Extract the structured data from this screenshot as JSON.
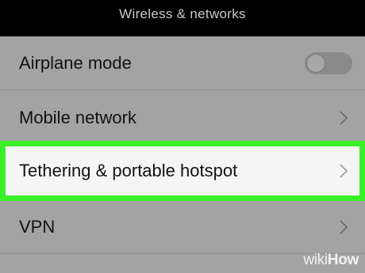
{
  "header": {
    "title": "Wireless & networks"
  },
  "settings": {
    "items": [
      {
        "label": "Airplane mode",
        "control": "toggle",
        "toggle_state": "off"
      },
      {
        "label": "Mobile network",
        "control": "chevron-right"
      },
      {
        "label": "Tethering & portable hotspot",
        "control": "chevron-right",
        "highlighted": true,
        "highlight_color": "#3af029"
      },
      {
        "label": "VPN",
        "control": "chevron-right"
      }
    ]
  },
  "watermark": {
    "part1": "wiki",
    "part2": "How"
  },
  "colors": {
    "header_bg": "#000000",
    "list_bg": "#a3a3a3",
    "highlight_border": "#3af029",
    "highlight_bg": "#f5f5f5"
  }
}
